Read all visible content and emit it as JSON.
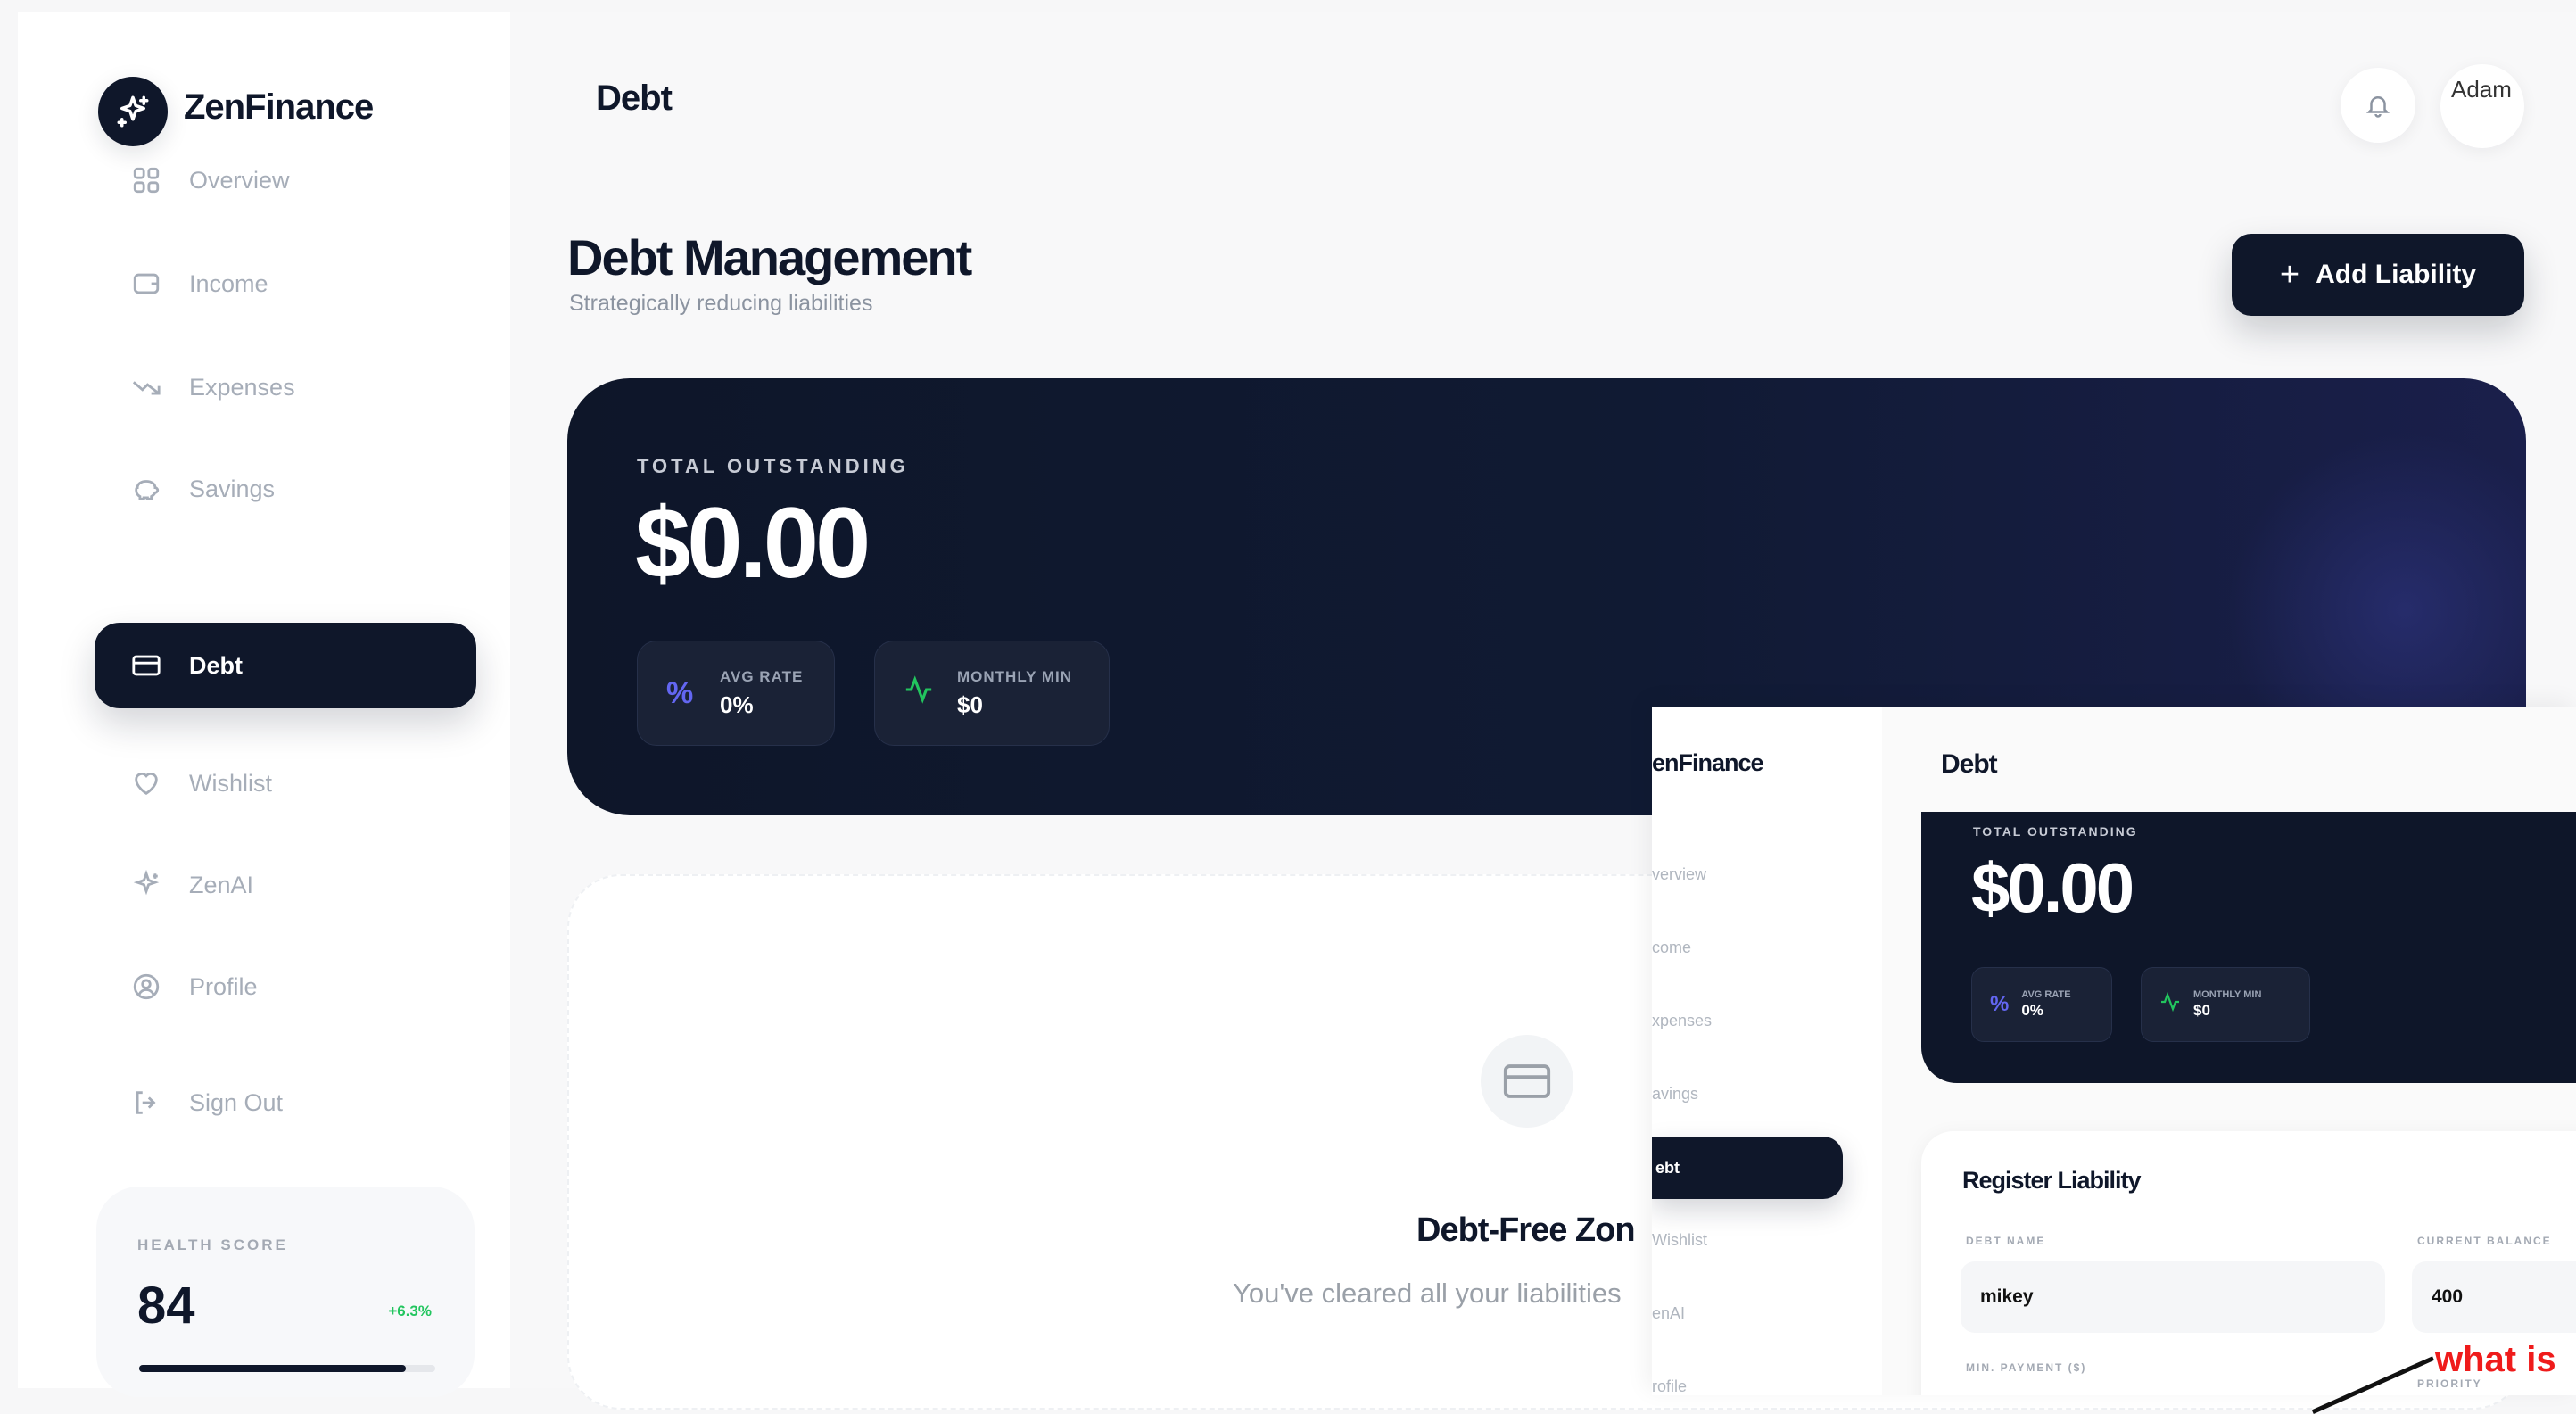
{
  "app": {
    "name": "ZenFinance",
    "page_header": "Debt"
  },
  "sidebar": {
    "items": [
      {
        "label": "Overview",
        "icon": "grid-icon"
      },
      {
        "label": "Income",
        "icon": "wallet-icon"
      },
      {
        "label": "Expenses",
        "icon": "trending-down-icon"
      },
      {
        "label": "Savings",
        "icon": "piggy-bank-icon"
      },
      {
        "label": "Debt",
        "icon": "credit-card-icon",
        "active": true
      },
      {
        "label": "Wishlist",
        "icon": "heart-icon"
      },
      {
        "label": "ZenAI",
        "icon": "sparkles-icon"
      },
      {
        "label": "Profile",
        "icon": "user-circle-icon"
      },
      {
        "label": "Sign Out",
        "icon": "log-out-icon"
      }
    ],
    "health": {
      "label": "HEALTH SCORE",
      "score": "84",
      "delta": "+6.3%",
      "progress": 0.9
    }
  },
  "header": {
    "avatar_alt": "Adam"
  },
  "main": {
    "title": "Debt Management",
    "subtitle": "Strategically reducing liabilities",
    "add_button": "Add Liability",
    "summary": {
      "label": "TOTAL OUTSTANDING",
      "value": "$0.00",
      "avg_rate_label": "AVG RATE",
      "avg_rate_value": "0%",
      "monthly_min_label": "MONTHLY MIN",
      "monthly_min_value": "$0"
    },
    "empty": {
      "title": "Debt-Free Zon",
      "subtitle": "You've cleared all your liabilities"
    }
  },
  "inset": {
    "brand": "enFinance",
    "header": "Debt",
    "nav": [
      "verview",
      "come",
      "xpenses",
      "avings",
      "ebt",
      "Wishlist",
      "enAI",
      "rofile"
    ],
    "summary": {
      "label": "TOTAL OUTSTANDING",
      "value": "$0.00",
      "avg_rate_label": "AVG RATE",
      "avg_rate_value": "0%",
      "monthly_min_label": "MONTHLY MIN",
      "monthly_min_value": "$0"
    },
    "form": {
      "title": "Register Liability",
      "debt_name_label": "DEBT NAME",
      "debt_name_value": "mikey",
      "balance_label": "CURRENT BALANCE",
      "balance_value": "400",
      "min_payment_label": "MIN. PAYMENT ($)",
      "priority_label": "PRIORITY"
    }
  },
  "annotation": {
    "text": "what is",
    "color": "#ef1b1b"
  },
  "colors": {
    "accent": "#0f172a",
    "positive": "#22c55e",
    "rate_icon": "#6366f1"
  }
}
